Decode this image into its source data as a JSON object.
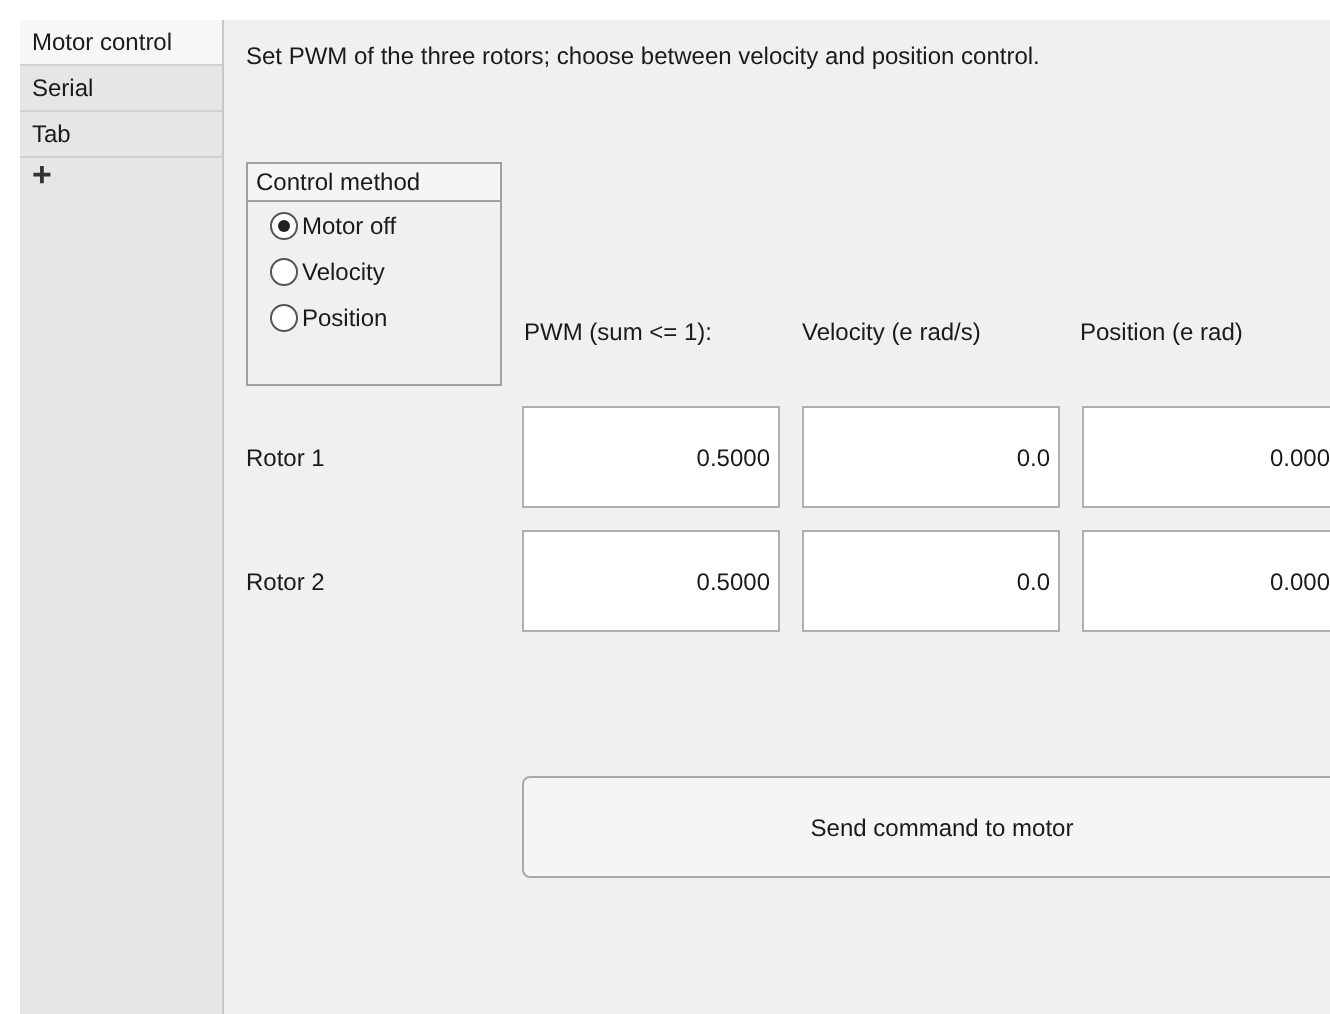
{
  "tabs": [
    {
      "label": "Motor control",
      "selected": true
    },
    {
      "label": "Serial",
      "selected": false
    },
    {
      "label": "Tab",
      "selected": false
    }
  ],
  "add_tab": "+",
  "description": "Set PWM of the three rotors; choose between velocity and position control.",
  "control_method": {
    "title": "Control method",
    "options": [
      {
        "label": "Motor off",
        "selected": true
      },
      {
        "label": "Velocity",
        "selected": false
      },
      {
        "label": "Position",
        "selected": false
      }
    ]
  },
  "columns": [
    "PWM (sum <= 1):",
    "Velocity (e rad/s)",
    "Position (e rad)"
  ],
  "rows": [
    {
      "label": "Rotor 1",
      "values": [
        "0.5000",
        "0.0",
        "0.000"
      ]
    },
    {
      "label": "Rotor 2",
      "values": [
        "0.5000",
        "0.0",
        "0.000"
      ]
    }
  ],
  "send_button": "Send command to motor"
}
